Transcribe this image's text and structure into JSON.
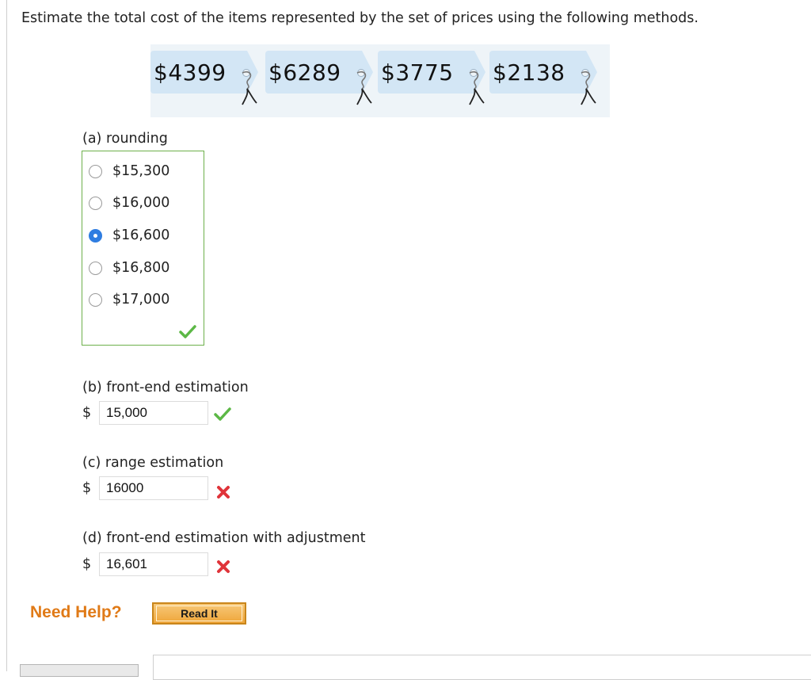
{
  "question": {
    "text": "Estimate the total cost of the items represented by the set of prices using the following methods."
  },
  "price_tags": [
    {
      "price": "$4399"
    },
    {
      "price": "$6289"
    },
    {
      "price": "$3775"
    },
    {
      "price": "$2138"
    }
  ],
  "part_a": {
    "label": "(a) rounding",
    "options": [
      "$15,300",
      "$16,000",
      "$16,600",
      "$16,800",
      "$17,000"
    ],
    "selected": "$16,600",
    "status": "correct"
  },
  "part_b": {
    "label": "(b) front-end estimation",
    "currency": "$",
    "value": "15,000",
    "status": "correct"
  },
  "part_c": {
    "label": "(c) range estimation",
    "currency": "$",
    "value": "16000",
    "status": "incorrect"
  },
  "part_d": {
    "label": "(d) front-end estimation with adjustment",
    "currency": "$",
    "value": "16,601",
    "status": "incorrect"
  },
  "help": {
    "need_help": "Need Help?",
    "read_it": "Read It"
  },
  "colors": {
    "correct": "#5cb846",
    "incorrect": "#e0343a",
    "selected_radio": "#2f7de1",
    "help_text": "#e07a17",
    "tag_fill": "#d3e6f5",
    "answer_box_border": "#6db04b"
  }
}
